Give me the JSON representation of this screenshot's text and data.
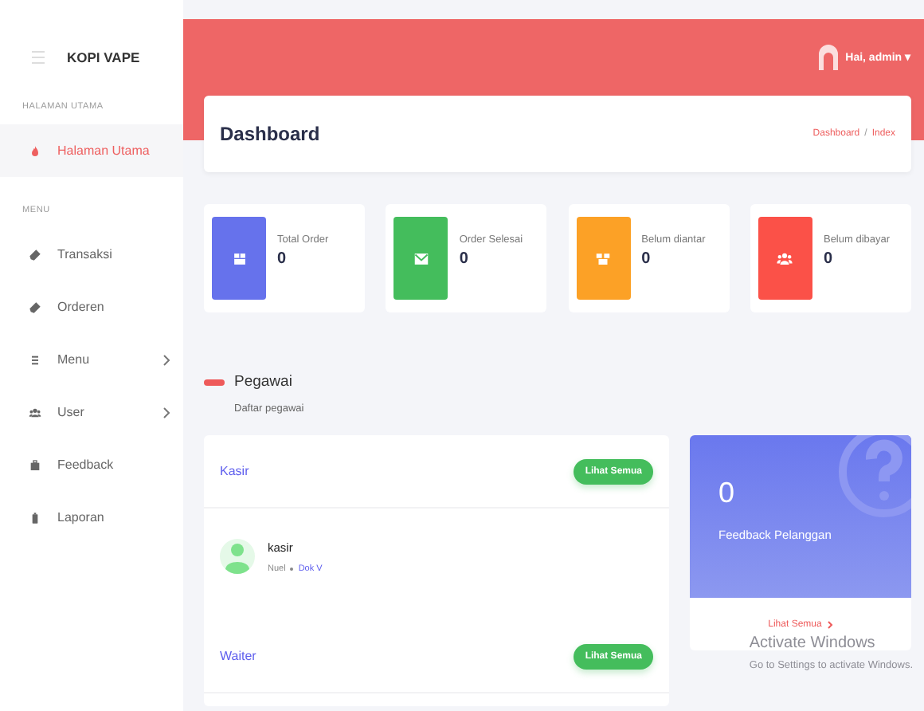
{
  "sidebar": {
    "brand": "KOPI VAPE",
    "sections": [
      {
        "title": "HALAMAN UTAMA",
        "items": [
          {
            "label": "Halaman Utama",
            "selected": true,
            "expandable": false
          }
        ]
      },
      {
        "title": "MENU",
        "items": [
          {
            "label": "Transaksi",
            "selected": false,
            "expandable": false
          },
          {
            "label": "Orderen",
            "selected": false,
            "expandable": false
          },
          {
            "label": "Menu",
            "selected": false,
            "expandable": true
          },
          {
            "label": "User",
            "selected": false,
            "expandable": true
          },
          {
            "label": "Feedback",
            "selected": false,
            "expandable": false
          },
          {
            "label": "Laporan",
            "selected": false,
            "expandable": false
          }
        ]
      }
    ]
  },
  "header": {
    "user": "Hai, admin",
    "caret": "▾"
  },
  "page": {
    "title": "Dashboard",
    "breadcrumb": [
      "Dashboard",
      "Index"
    ],
    "separator": "/"
  },
  "stats": [
    {
      "label": "Total Order",
      "value": "0",
      "color": "#6672ec"
    },
    {
      "label": "Order Selesai",
      "value": "0",
      "color": "#44bd5c"
    },
    {
      "label": "Belum diantar",
      "value": "0",
      "color": "#fca126"
    },
    {
      "label": "Belum dibayar",
      "value": "0",
      "color": "#fb5148"
    }
  ],
  "section": {
    "title": "Pegawai",
    "subtitle": "Daftar pegawai"
  },
  "employees": {
    "groups": [
      {
        "title": "Kasir",
        "button": "Lihat Semua",
        "members": [
          {
            "name": "kasir",
            "tag": "Nuel",
            "link": "Dok V"
          }
        ]
      },
      {
        "title": "Waiter",
        "button": "Lihat Semua"
      }
    ]
  },
  "feedback": {
    "value": "0",
    "label": "Feedback Pelanggan",
    "link": "Lihat Semua"
  },
  "os_notice": {
    "title": "Activate Windows",
    "text": "Go to Settings to activate Windows."
  }
}
